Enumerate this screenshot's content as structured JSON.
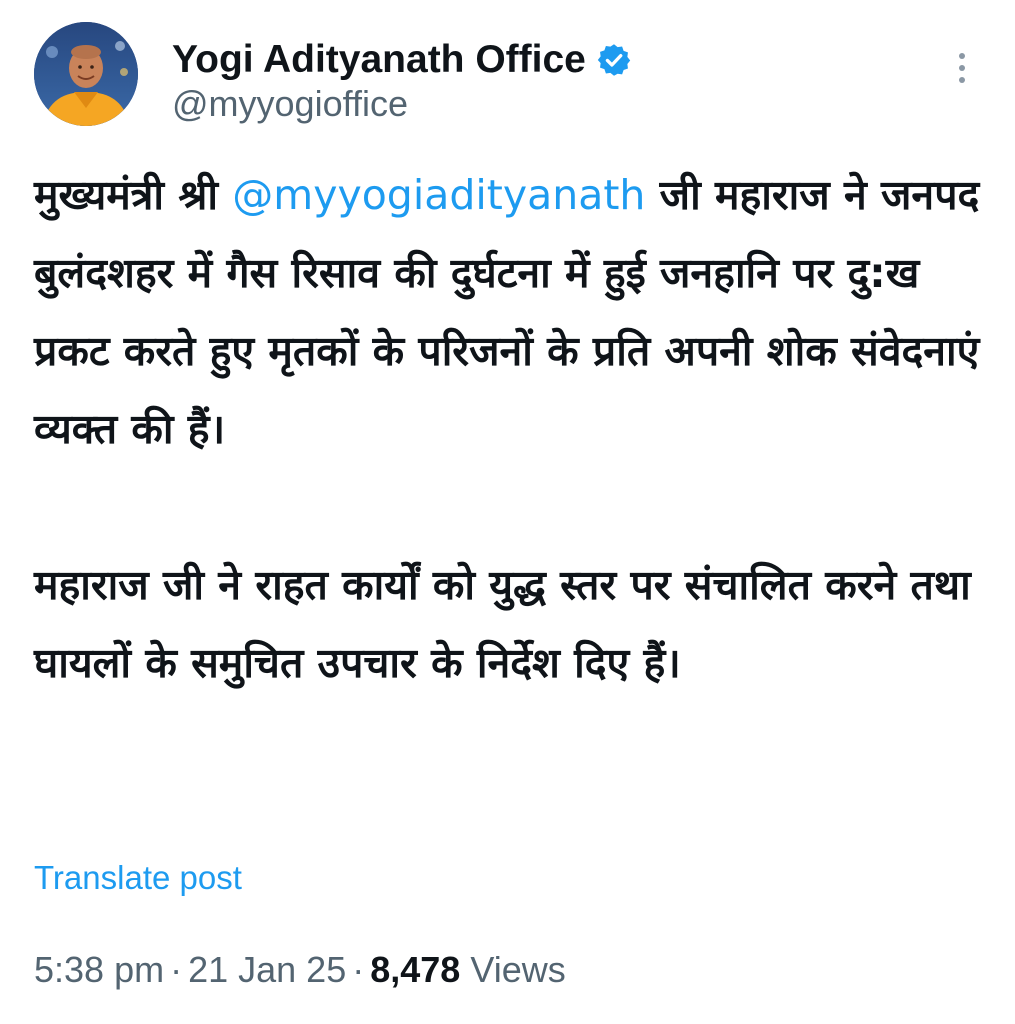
{
  "author": {
    "display_name": "Yogi Adityanath Office",
    "handle": "@myyogioffice",
    "verified": true
  },
  "tweet": {
    "para1_before": "मुख्यमंत्री श्री ",
    "mention": "@myyogiadityanath",
    "para1_after": " जी महाराज ने जनपद बुलंदशहर में गैस रिसाव की दुर्घटना में हुई जनहानि पर दु:ख प्रकट करते हुए मृतकों के परिजनों के प्रति अपनी शोक संवेदनाएं व्यक्त की हैं।",
    "para2": "महाराज जी ने राहत कार्यों को युद्ध स्तर पर संचालित करने तथा घायलों के समुचित उपचार के निर्देश दिए हैं।"
  },
  "translate_label": "Translate post",
  "meta": {
    "time": "5:38 pm",
    "date": "21 Jan 25",
    "views_count": "8,478",
    "views_label": "Views",
    "separator": "·"
  },
  "icons": {
    "verified": "verified-badge-icon",
    "more": "more-vertical-icon"
  },
  "colors": {
    "link": "#1d9bf0",
    "text": "#0f1419",
    "secondary": "#536471",
    "saffron": "#f5a623"
  }
}
